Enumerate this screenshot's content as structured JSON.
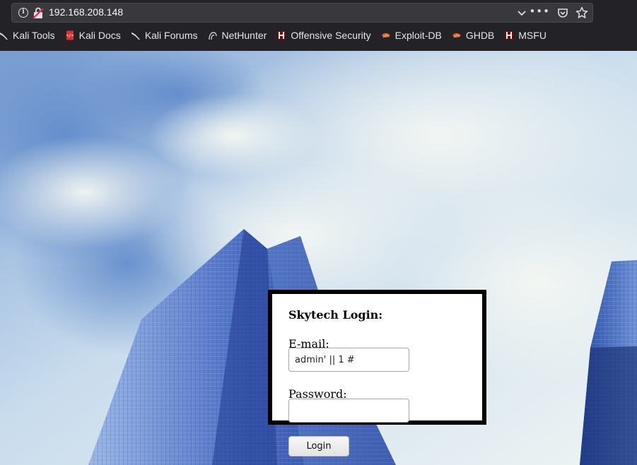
{
  "browser": {
    "url": "192.168.208.148",
    "bookmarks": [
      {
        "label": "Kali Tools",
        "icon": "kali-dragon-icon"
      },
      {
        "label": "Kali Docs",
        "icon": "kali-docs-icon"
      },
      {
        "label": "Kali Forums",
        "icon": "kali-dragon-icon"
      },
      {
        "label": "NetHunter",
        "icon": "nethunter-icon"
      },
      {
        "label": "Offensive Security",
        "icon": "offsec-icon"
      },
      {
        "label": "Exploit-DB",
        "icon": "exploit-db-icon"
      },
      {
        "label": "GHDB",
        "icon": "ghdb-icon"
      },
      {
        "label": "MSFU",
        "icon": "msfu-icon"
      }
    ]
  },
  "login": {
    "title": "Skytech Login:",
    "email_label": "E-mail:",
    "email_value": "admin' || 1 #",
    "password_label": "Password:",
    "password_value": "",
    "button_label": "Login"
  },
  "colors": {
    "chrome_bg": "#232327",
    "urlbar_bg": "#38383d",
    "box_border": "#000000"
  }
}
